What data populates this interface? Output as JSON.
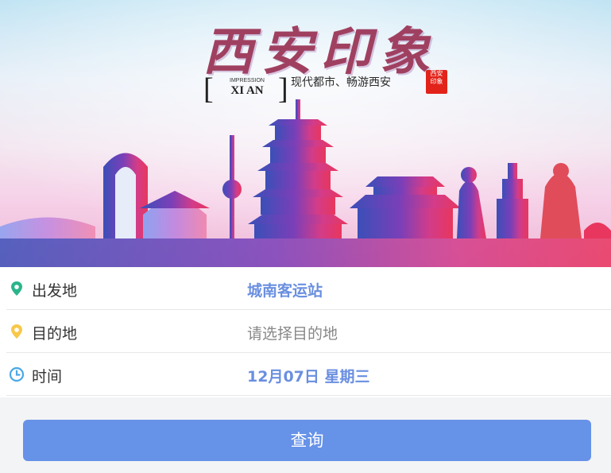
{
  "banner": {
    "title_cn": "西安印象",
    "impression_label": "IMPRESSION",
    "xian_label": "XI AN",
    "slogan": "现代都市、畅游西安",
    "seal_text": "西安印象"
  },
  "form": {
    "departure": {
      "label": "出发地",
      "value": "城南客运站"
    },
    "destination": {
      "label": "目的地",
      "placeholder": "请选择目的地"
    },
    "time": {
      "label": "时间",
      "value": "12月07日 星期三"
    }
  },
  "query_button": {
    "label": "查询"
  },
  "colors": {
    "accent_blue": "#6a8fe0",
    "button_blue": "#6692e8",
    "location_green": "#2bb58b",
    "location_yellow": "#f7c84a",
    "clock_blue": "#4aa8e6"
  },
  "icons": [
    "location-pin-icon",
    "location-pin-icon",
    "clock-icon"
  ]
}
